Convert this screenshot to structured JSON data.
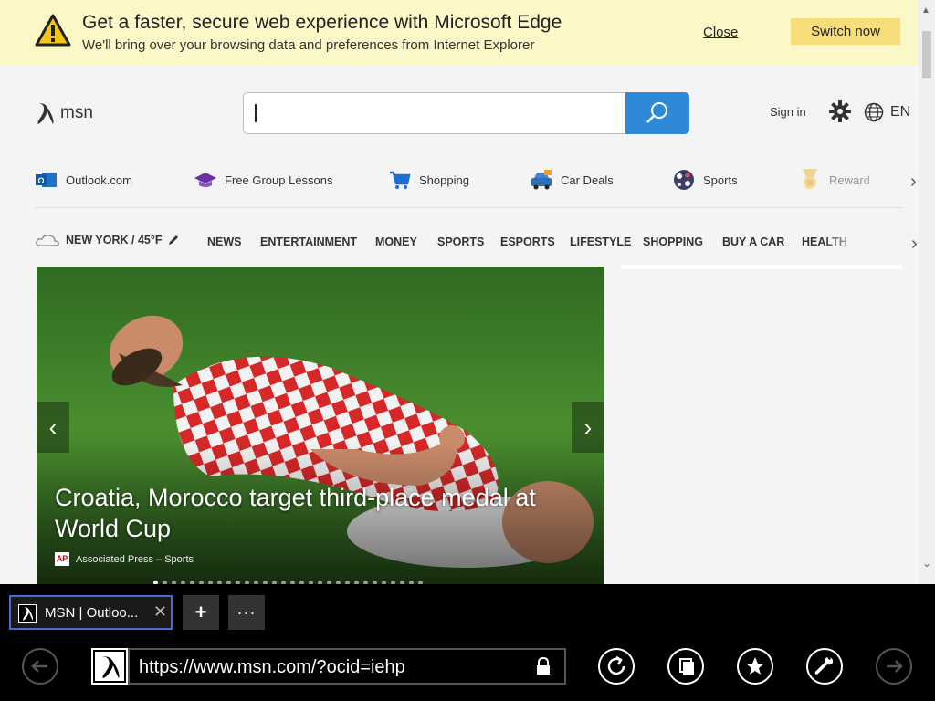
{
  "banner": {
    "title": "Get a faster, secure web experience with Microsoft Edge",
    "subtitle": "We'll bring over your browsing data and preferences from Internet Explorer",
    "close_label": "Close",
    "switch_label": "Switch now"
  },
  "header": {
    "logo_text": "msn",
    "search_placeholder": "",
    "signin_label": "Sign in",
    "lang_label": "EN"
  },
  "quick_links": [
    {
      "label": "Outlook.com",
      "icon": "outlook-icon"
    },
    {
      "label": "Free Group Lessons",
      "icon": "graduation-cap-icon"
    },
    {
      "label": "Shopping",
      "icon": "shopping-cart-icon"
    },
    {
      "label": "Car Deals",
      "icon": "car-icon"
    },
    {
      "label": "Sports",
      "icon": "soccer-ball-icon"
    },
    {
      "label": "Reward",
      "icon": "medal-icon"
    }
  ],
  "nav": {
    "weather": "NEW YORK / 45°F",
    "items": [
      "NEWS",
      "ENTERTAINMENT",
      "MONEY",
      "SPORTS",
      "ESPORTS",
      "LIFESTYLE",
      "SHOPPING",
      "BUY A CAR",
      "HEALTH"
    ]
  },
  "hero": {
    "title": "Croatia, Morocco target third-place medal at World Cup",
    "source": "Associated Press – Sports",
    "source_logo": "AP",
    "slide_count": 30,
    "active_slide": 1
  },
  "browser": {
    "tab_title": "MSN | Outloo...",
    "tab_close": "✕",
    "new_tab": "+",
    "tab_menu": "···",
    "url": "https://www.msn.com/?ocid=iehp"
  },
  "colors": {
    "banner_bg": "#fcf7c6",
    "switch_bg": "#f8de7b",
    "search_accent": "#2f88d8",
    "tab_border": "#4c6bd0"
  }
}
